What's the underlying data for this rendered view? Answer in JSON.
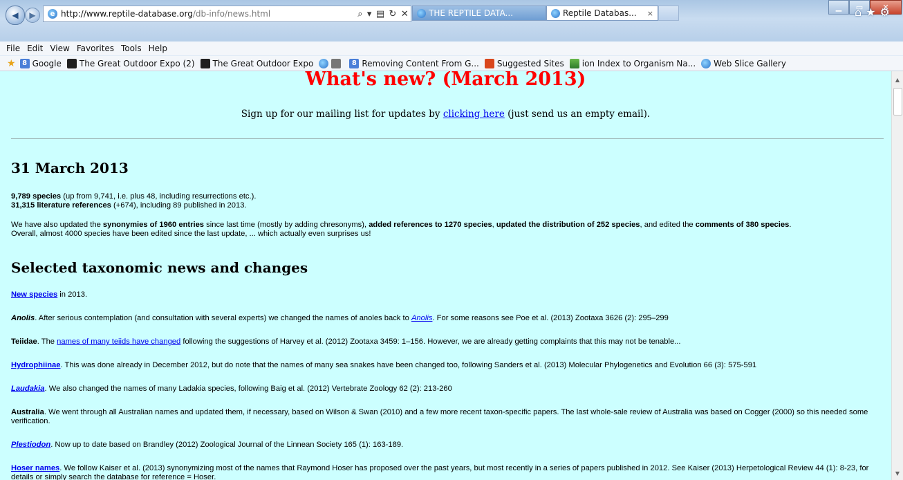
{
  "browser": {
    "url_host": "http://www.reptile-database.org",
    "url_path": "/db-info/news.html",
    "tabs": [
      {
        "label": "THE REPTILE DATA..."
      },
      {
        "label": "Reptile Databas..."
      }
    ],
    "tab_close_glyph": "×",
    "menu": [
      "File",
      "Edit",
      "View",
      "Favorites",
      "Tools",
      "Help"
    ],
    "favorites": [
      {
        "label": "Google",
        "icon": "google-icon"
      },
      {
        "label": "The Great Outdoor Expo (2)",
        "icon": "dark-square-icon"
      },
      {
        "label": "The Great Outdoor Expo",
        "icon": "dark-square-icon"
      },
      {
        "label": "Removing Content From G...",
        "icon": "google-icon"
      },
      {
        "label": "Suggested Sites",
        "icon": "suggested-sites-icon"
      },
      {
        "label": "ion Index to Organism Na...",
        "icon": "ion-icon"
      },
      {
        "label": "Web Slice Gallery",
        "icon": "ie-icon"
      }
    ]
  },
  "page": {
    "title": "What's new? (March 2013)",
    "mailing": {
      "before": "Sign up for our mailing list for updates by ",
      "link": "clicking here",
      "after": " (just send us an empty email)."
    },
    "date_heading": "31 March 2013",
    "stats": {
      "species_bold": "9,789 species",
      "species_rest": " (up from 9,741, i.e. plus 48, including resurrections etc.).",
      "refs_bold": "31,315 literature references",
      "refs_rest": " (+674), including 89 published in 2013."
    },
    "update": {
      "t1": "We have also updated the ",
      "b1": "synonymies of 1960 entries",
      "t2": " since last time (mostly by adding chresonyms), ",
      "b2": "added references to 1270 species",
      "t3": ", ",
      "b3": "updated the distribution of 252 species",
      "t4": ", and edited the ",
      "b4": "comments of 380 species",
      "t5": ".",
      "line2": "Overall, almost 4000 species have been edited since the last update, ... which actually even surprises us!"
    },
    "selected_heading": "Selected taxonomic news and changes",
    "news": {
      "new_species_link": "New species",
      "new_species_rest": " in 2013.",
      "anolis_bold": "Anolis",
      "anolis_text": ". After serious contemplation (and consultation with several experts) we changed the names of anoles back to ",
      "anolis_link": "Anolis",
      "anolis_rest": ". For some reasons see Poe et al. (2013) Zootaxa 3626 (2): 295–299",
      "teiidae_bold": "Teiidae",
      "teiidae_text": ". The ",
      "teiidae_link": "names of many teiids have changed",
      "teiidae_rest": " following the suggestions of Harvey et al. (2012) Zootaxa 3459: 1–156. However, we are already getting complaints that this may not be tenable...",
      "hydro_link": "Hydrophiinae",
      "hydro_rest": ". This was done already in December 2012, but do note that the names of many sea snakes have been changed too, following Sanders et al. (2013) Molecular Phylogenetics and Evolution 66 (3): 575-591",
      "laudakia_link": "Laudakia",
      "laudakia_rest": ". We also changed the names of many Ladakia species, following Baig et al. (2012) Vertebrate Zoology 62 (2): 213-260",
      "australia_bold": "Australia",
      "australia_rest": ". We went through all Australian names and updated them, if necessary, based on Wilson & Swan (2010) and a few more recent taxon-specific papers. The last whole-sale review of Australia was based on Cogger (2000) so this needed some verification.",
      "plestiodon_link": "Plestiodon",
      "plestiodon_rest": ". Now up to date based on Brandley (2012) Zoological Journal of the Linnean Society 165 (1): 163-189.",
      "hoser_link": "Hoser names",
      "hoser_rest": ". We follow Kaiser et al. (2013) synonymizing most of the names that Raymond Hoser has proposed over the past years, but most recently in a series of papers published in 2012. See Kaiser (2013) Herpetological Review 44 (1): 8-23, for details or simply search the database for reference = Hoser."
    }
  }
}
